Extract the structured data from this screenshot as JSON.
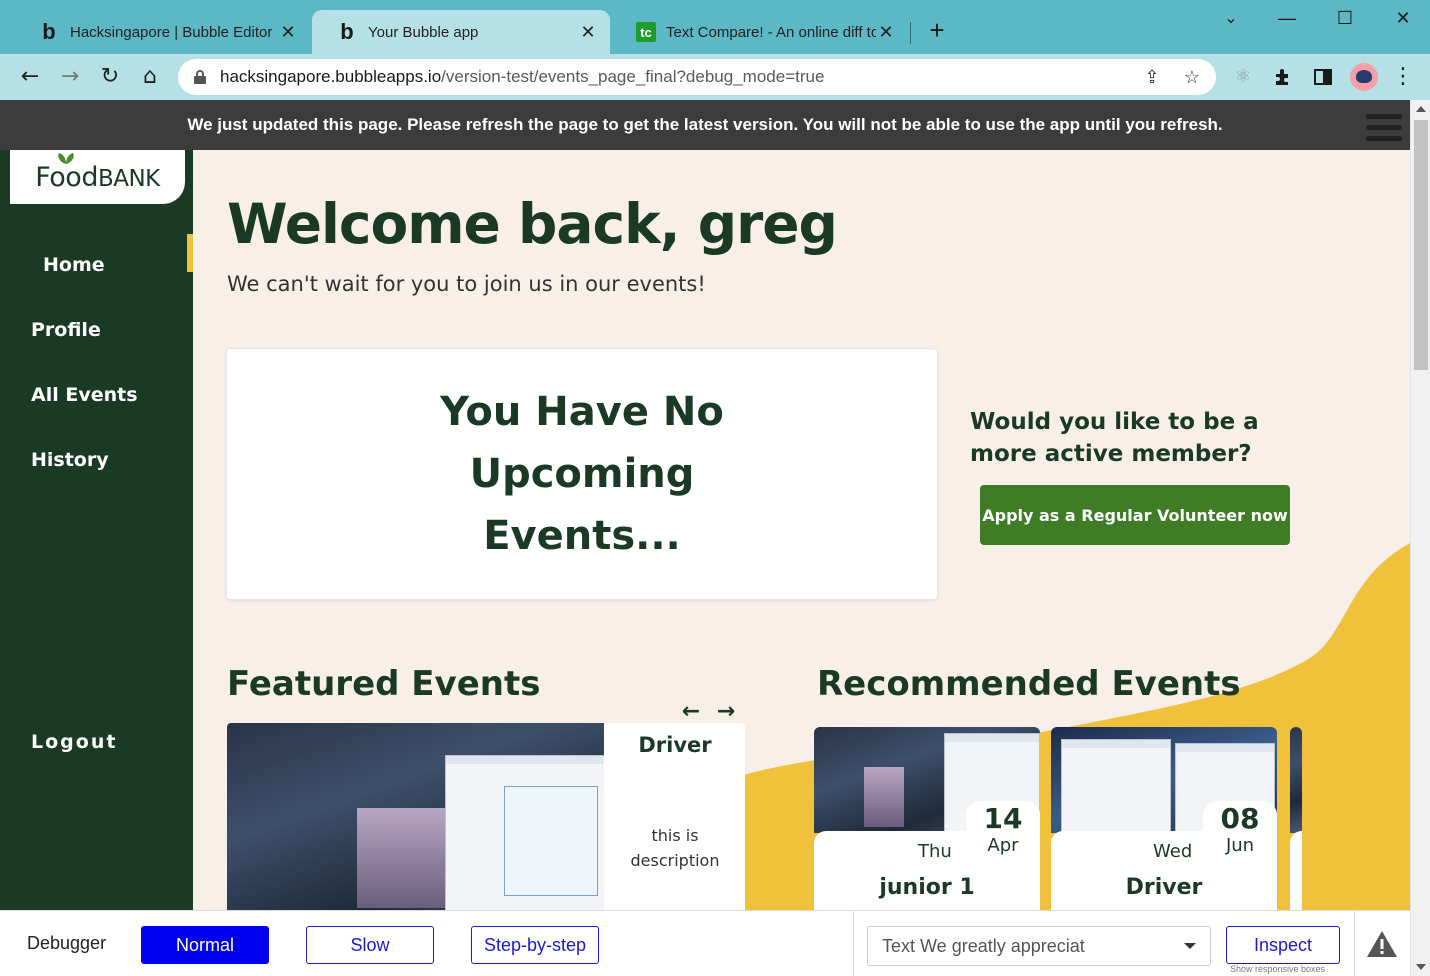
{
  "browser": {
    "tabs": [
      {
        "title": "Hacksingapore | Bubble Editor",
        "favicon": "bubble-b",
        "active": false
      },
      {
        "title": "Your Bubble app",
        "favicon": "bubble-b",
        "active": true
      },
      {
        "title": "Text Compare! - An online diff to",
        "favicon": "tc",
        "active": false
      }
    ],
    "new_tab_symbol": "+",
    "window_controls": {
      "minimize": "—",
      "maximize": "☐",
      "close": "✕",
      "tab_search": "⌄"
    },
    "nav": {
      "back": "←",
      "forward": "→",
      "reload": "↻",
      "home": "⌂"
    },
    "url": {
      "host": "hacksingapore.bubbleapps.io",
      "path": "/version-test/events_page_final?debug_mode=true"
    },
    "omnibox_icons": {
      "share": "⇪",
      "bookmark": "☆"
    },
    "extensions": [
      "react-devtools-icon",
      "puzzle-extensions-icon",
      "side-panel-icon"
    ],
    "menu_symbol": "⋮"
  },
  "banner": {
    "text": "We just updated this page. Please refresh the page to get the latest version. You will not be able to use the app until you refresh."
  },
  "sidebar": {
    "logo": {
      "text_a": "Fo",
      "text_b": "od",
      "text_c": "BANK"
    },
    "items": [
      {
        "label": "Home",
        "active": true
      },
      {
        "label": "Profile",
        "active": false
      },
      {
        "label": "All Events",
        "active": false
      },
      {
        "label": "History",
        "active": false
      }
    ],
    "logout": "Logout"
  },
  "main": {
    "welcome": "Welcome back, greg",
    "subtitle": "We can't wait for you to join us in our events!",
    "no_events": "You Have No Upcoming Events...",
    "volunteer_question": "Would you like to be a more active member?",
    "apply_button": "Apply as a Regular Volunteer now",
    "featured": {
      "title": "Featured Events",
      "prev": "←",
      "next": "→",
      "card": {
        "title": "Driver",
        "description": "this is description"
      }
    },
    "recommended": {
      "title": "Recommended Events",
      "cards": [
        {
          "day": "14",
          "month": "Apr",
          "weekday": "Thu",
          "title": "junior 1"
        },
        {
          "day": "08",
          "month": "Jun",
          "weekday": "Wed",
          "title": "Driver"
        }
      ]
    }
  },
  "debugger": {
    "label": "Debugger",
    "modes": [
      {
        "label": "Normal",
        "selected": true
      },
      {
        "label": "Slow",
        "selected": false
      },
      {
        "label": "Step-by-step",
        "selected": false
      }
    ],
    "element_select": "Text We greatly appreciat",
    "inspect": "Inspect",
    "show_boxes": "Show responsive boxes"
  },
  "colors": {
    "sidebar_bg": "#1b3a25",
    "accent_yellow": "#f0c23c",
    "page_bg": "#f8efe9",
    "apply_button_bg": "#3e7c26",
    "tab_bar": "#5cb8c4",
    "debug_blue": "#0000ee"
  }
}
